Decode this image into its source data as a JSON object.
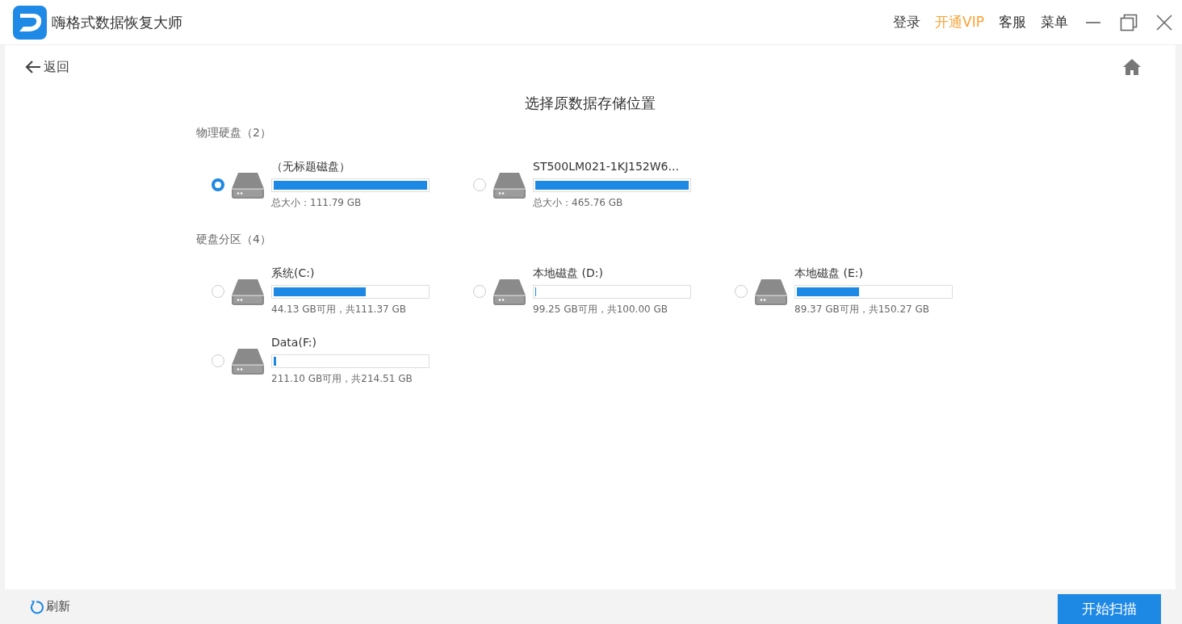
{
  "window": {
    "title": "嗨格式数据恢复大师",
    "menu": [
      {
        "label": "登录",
        "kind": "plain"
      },
      {
        "label": "开通VIP",
        "kind": "vip"
      },
      {
        "label": "客服",
        "kind": "plain"
      },
      {
        "label": "菜单",
        "kind": "plain"
      }
    ]
  },
  "back": {
    "label": "返回"
  },
  "heading": "选择原数据存储位置",
  "sections": [
    {
      "title": "物理硬盘（2）",
      "items": [
        {
          "name": "（无标题磁盘）",
          "level": 1,
          "info": "总大小：111.79 GB",
          "selected": true
        },
        {
          "name": "ST500LM021-1KJ152W6...",
          "level": 1,
          "info": "总大小：465.76 GB",
          "selected": false
        }
      ]
    },
    {
      "title": "硬盘分区（4）",
      "items": [
        {
          "name": "系统(C:)",
          "level": 0.6,
          "info": "44.13 GB可用，共111.37 GB",
          "selected": false
        },
        {
          "name": "本地磁盘 (D:)",
          "level": 0.0075,
          "info": "99.25 GB可用，共100.00 GB",
          "selected": false
        },
        {
          "name": "本地磁盘 (E:)",
          "level": 0.405,
          "info": "89.37 GB可用，共150.27 GB",
          "selected": false
        },
        {
          "name": "Data(F:)",
          "level": 0.016,
          "info": "211.10 GB可用，共214.51 GB",
          "selected": false
        }
      ]
    }
  ],
  "footer": {
    "refresh": "刷新",
    "start": "开始扫描"
  }
}
